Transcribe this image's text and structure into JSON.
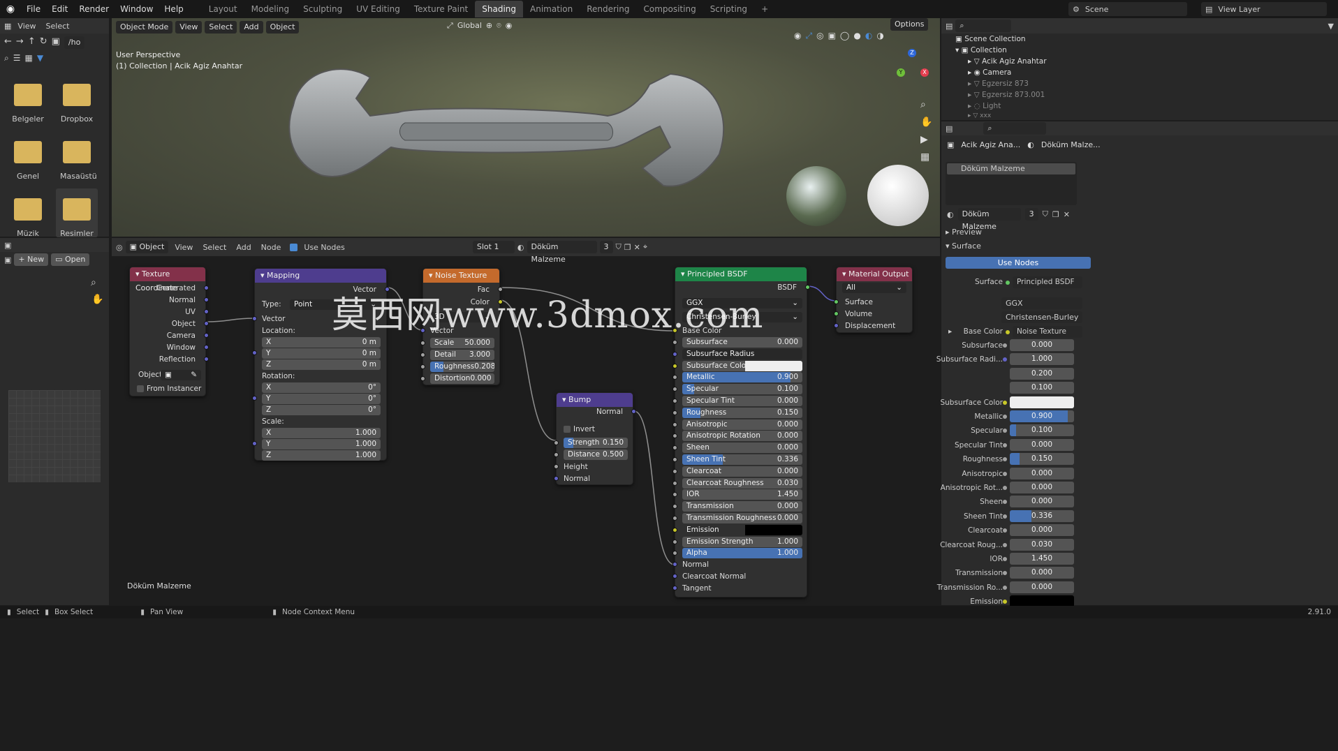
{
  "topbar": {
    "menus": [
      "File",
      "Edit",
      "Render",
      "Window",
      "Help"
    ],
    "workspaces": [
      "Layout",
      "Modeling",
      "Sculpting",
      "UV Editing",
      "Texture Paint",
      "Shading",
      "Animation",
      "Rendering",
      "Compositing",
      "Scripting"
    ],
    "active_workspace": "Shading",
    "scene": "Scene",
    "view_layer": "View Layer"
  },
  "filebrowser": {
    "view": "View",
    "select": "Select",
    "path": "/ho",
    "folders": [
      "Belgeler",
      "Dropbox",
      "Genel",
      "Masaüstü",
      "Müzik",
      "Resimler"
    ]
  },
  "image_editor": {
    "new": "New",
    "open": "Open"
  },
  "viewport": {
    "mode": "Object Mode",
    "menus": [
      "View",
      "Select",
      "Add",
      "Object"
    ],
    "orientation": "Global",
    "options": "Options",
    "info1": "User Perspective",
    "info2": "(1) Collection | Acik Agiz Anahtar",
    "axis_x": "X",
    "axis_y": "Y",
    "axis_z": "Z"
  },
  "node_editor": {
    "type": "Object",
    "menus": [
      "View",
      "Select",
      "Add",
      "Node"
    ],
    "use_nodes": "Use Nodes",
    "slot": "Slot 1",
    "material": "Döküm Malzeme",
    "users": "3",
    "footer_material": "Döküm Malzeme"
  },
  "nodes": {
    "texcoord": {
      "title": "Texture Coordinate",
      "outputs": [
        "Generated",
        "Normal",
        "UV",
        "Object",
        "Camera",
        "Window",
        "Reflection"
      ],
      "object_label": "Object:",
      "from_instancer": "From Instancer"
    },
    "mapping": {
      "title": "Mapping",
      "out": "Vector",
      "type_label": "Type:",
      "type_val": "Point",
      "in_vector": "Vector",
      "location": "Location:",
      "rotation": "Rotation:",
      "scale": "Scale:",
      "loc": [
        {
          "k": "X",
          "v": "0 m"
        },
        {
          "k": "Y",
          "v": "0 m"
        },
        {
          "k": "Z",
          "v": "0 m"
        }
      ],
      "rot": [
        {
          "k": "X",
          "v": "0°"
        },
        {
          "k": "Y",
          "v": "0°"
        },
        {
          "k": "Z",
          "v": "0°"
        }
      ],
      "scl": [
        {
          "k": "X",
          "v": "1.000"
        },
        {
          "k": "Y",
          "v": "1.000"
        },
        {
          "k": "Z",
          "v": "1.000"
        }
      ]
    },
    "noise": {
      "title": "Noise Texture",
      "fac": "Fac",
      "color": "Color",
      "dim": "3D",
      "vector": "Vector",
      "fields": [
        {
          "k": "Scale",
          "v": "50.000"
        },
        {
          "k": "Detail",
          "v": "3.000"
        },
        {
          "k": "Roughness",
          "v": "0.208"
        },
        {
          "k": "Distortion",
          "v": "0.000"
        }
      ]
    },
    "bump": {
      "title": "Bump",
      "normal_out": "Normal",
      "invert": "Invert",
      "strength": {
        "k": "Strength",
        "v": "0.150"
      },
      "distance": {
        "k": "Distance",
        "v": "0.500"
      },
      "height": "Height",
      "normal_in": "Normal"
    },
    "bsdf": {
      "title": "Principled BSDF",
      "out": "BSDF",
      "dist": "GGX",
      "sss": "Christensen-Burley",
      "base_color": "Base Color",
      "fields": [
        {
          "k": "Subsurface",
          "v": "0.000"
        },
        {
          "k": "Subsurface Radius",
          "v": ""
        },
        {
          "k": "Subsurface Color",
          "v": ""
        },
        {
          "k": "Metallic",
          "v": "0.900"
        },
        {
          "k": "Specular",
          "v": "0.100"
        },
        {
          "k": "Specular Tint",
          "v": "0.000"
        },
        {
          "k": "Roughness",
          "v": "0.150"
        },
        {
          "k": "Anisotropic",
          "v": "0.000"
        },
        {
          "k": "Anisotropic Rotation",
          "v": "0.000"
        },
        {
          "k": "Sheen",
          "v": "0.000"
        },
        {
          "k": "Sheen Tint",
          "v": "0.336"
        },
        {
          "k": "Clearcoat",
          "v": "0.000"
        },
        {
          "k": "Clearcoat Roughness",
          "v": "0.030"
        },
        {
          "k": "IOR",
          "v": "1.450"
        },
        {
          "k": "Transmission",
          "v": "0.000"
        },
        {
          "k": "Transmission Roughness",
          "v": "0.000"
        },
        {
          "k": "Emission",
          "v": ""
        },
        {
          "k": "Emission Strength",
          "v": "1.000"
        },
        {
          "k": "Alpha",
          "v": "1.000"
        }
      ],
      "tail": [
        "Normal",
        "Clearcoat Normal",
        "Tangent"
      ]
    },
    "output": {
      "title": "Material Output",
      "target": "All",
      "inputs": [
        "Surface",
        "Volume",
        "Displacement"
      ]
    }
  },
  "outliner": {
    "scene_collection": "Scene Collection",
    "items": [
      "Collection",
      "Acik Agiz Anahtar",
      "Camera",
      "Egzersiz 873",
      "Egzersiz 873.001",
      "Light",
      "xxx"
    ]
  },
  "properties": {
    "object": "Acik Agiz Ana...",
    "material_tab": "Döküm Malze...",
    "slot_name": "Döküm Malzeme",
    "mat_name": "Döküm Malzeme",
    "users": "3",
    "preview": "Preview",
    "surface": "Surface",
    "use_nodes": "Use Nodes",
    "surface_label": "Surface",
    "surface_val": "Principled BSDF",
    "dist": "GGX",
    "sss": "Christensen-Burley",
    "base_color_label": "Base Color",
    "base_color_val": "Noise Texture",
    "rows": [
      {
        "k": "Subsurface",
        "v": "0.000"
      },
      {
        "k": "Subsurface Radi...",
        "v": "1.000"
      },
      {
        "k": "",
        "v": "0.200"
      },
      {
        "k": "",
        "v": "0.100"
      },
      {
        "k": "Subsurface Color",
        "v": ""
      },
      {
        "k": "Metallic",
        "v": "0.900"
      },
      {
        "k": "Specular",
        "v": "0.100"
      },
      {
        "k": "Specular Tint",
        "v": "0.000"
      },
      {
        "k": "Roughness",
        "v": "0.150"
      },
      {
        "k": "Anisotropic",
        "v": "0.000"
      },
      {
        "k": "Anisotropic Rot...",
        "v": "0.000"
      },
      {
        "k": "Sheen",
        "v": "0.000"
      },
      {
        "k": "Sheen Tint",
        "v": "0.336"
      },
      {
        "k": "Clearcoat",
        "v": "0.000"
      },
      {
        "k": "Clearcoat Roug...",
        "v": "0.030"
      },
      {
        "k": "IOR",
        "v": "1.450"
      },
      {
        "k": "Transmission",
        "v": "0.000"
      },
      {
        "k": "Transmission Ro...",
        "v": "0.000"
      },
      {
        "k": "Emission",
        "v": ""
      }
    ]
  },
  "statusbar": {
    "select": "Select",
    "box_select": "Box Select",
    "pan_view": "Pan View",
    "node_context": "Node Context Menu",
    "version": "2.91.0"
  },
  "watermark": "莫西网www.3dmox.com"
}
